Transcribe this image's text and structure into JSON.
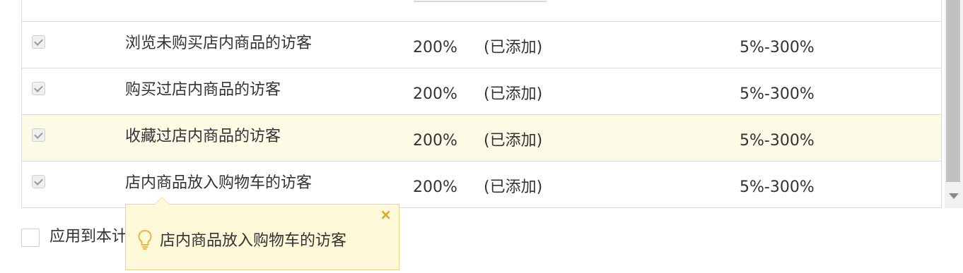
{
  "rows": [
    {
      "name": "浏览未购买店内商品的访客",
      "percent": "200%",
      "status": "(已添加)",
      "range": "5%-300%"
    },
    {
      "name": "购买过店内商品的访客",
      "percent": "200%",
      "status": "(已添加)",
      "range": "5%-300%"
    },
    {
      "name": "收藏过店内商品的访客",
      "percent": "200%",
      "status": "(已添加)",
      "range": "5%-300%"
    },
    {
      "name": "店内商品放入购物车的访客",
      "percent": "200%",
      "status": "(已添加)",
      "range": "5%-300%"
    }
  ],
  "apply": {
    "label": "应用到本计"
  },
  "tooltip": {
    "text": "店内商品放入购物车的访客",
    "close": "×"
  },
  "colors": {
    "highlight_row": "#fbfbe6",
    "tooltip_bg": "#fff9d9",
    "tooltip_border": "#f1d487",
    "accent": "#e0a128"
  }
}
